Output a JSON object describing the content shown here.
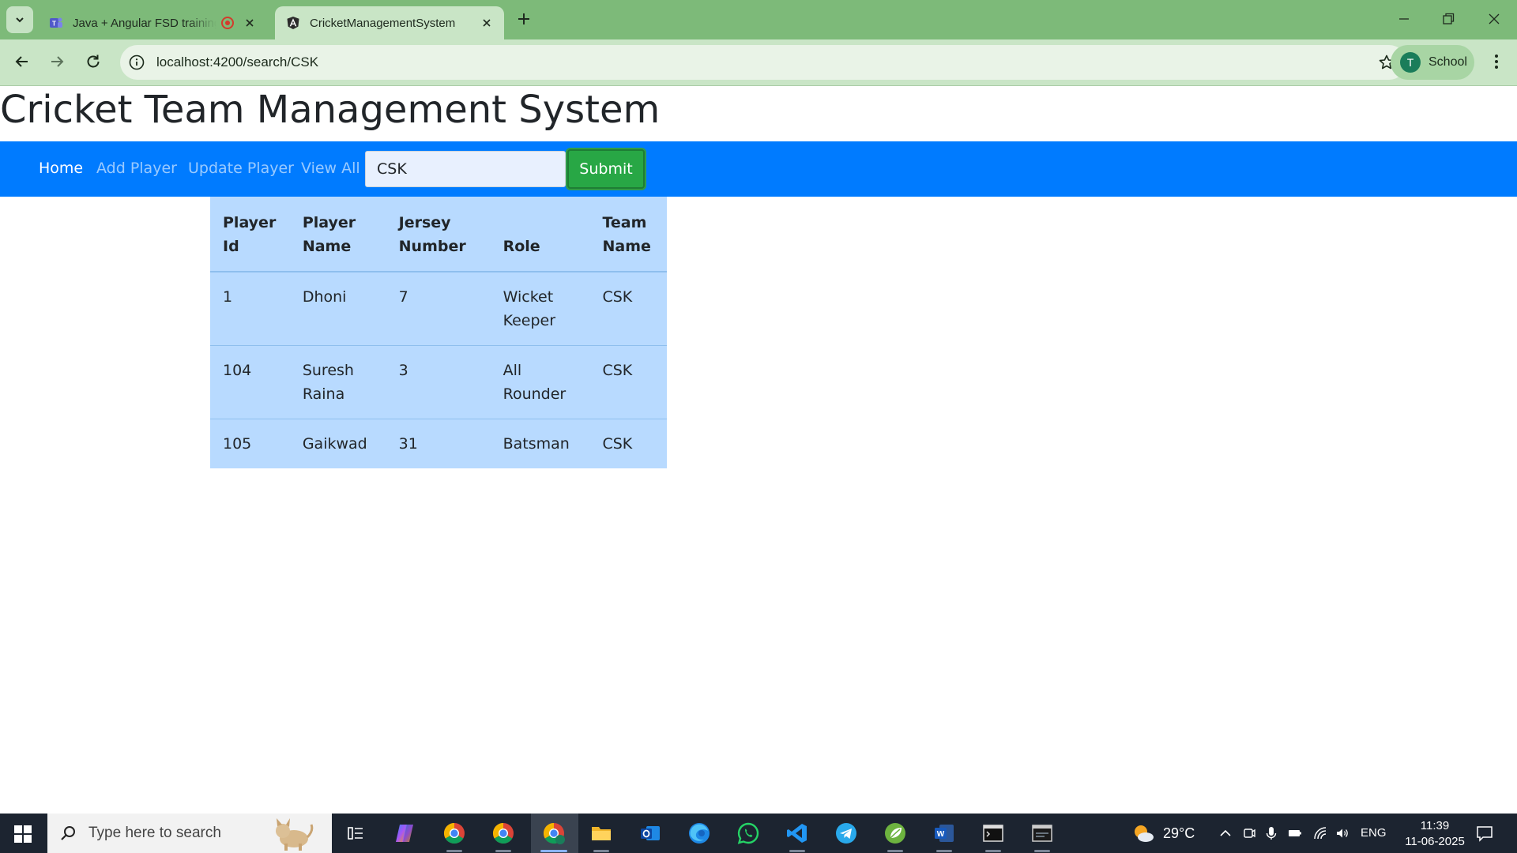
{
  "browser": {
    "tabs": [
      {
        "title": "Java + Angular FSD training"
      },
      {
        "title": "CricketManagementSystem"
      }
    ],
    "url": "localhost:4200/search/CSK",
    "profile": {
      "initial": "T",
      "name": "School"
    }
  },
  "app": {
    "title": "Cricket Team Management System",
    "nav": {
      "home": "Home",
      "add_player": "Add Player",
      "update_player": "Update Player",
      "view_all": "View All",
      "search_value": "CSK",
      "submit": "Submit"
    },
    "table": {
      "headers": {
        "id": "Player Id",
        "name": "Player Name",
        "jersey": "Jersey Number",
        "role": "Role",
        "team": "Team Name"
      },
      "rows": [
        {
          "id": "1",
          "name": "Dhoni",
          "jersey": "7",
          "role": "Wicket Keeper",
          "team": "CSK"
        },
        {
          "id": "104",
          "name": "Suresh Raina",
          "jersey": "3",
          "role": "All Rounder",
          "team": "CSK"
        },
        {
          "id": "105",
          "name": "Gaikwad",
          "jersey": "31",
          "role": "Batsman",
          "team": "CSK"
        }
      ]
    }
  },
  "taskbar": {
    "search_placeholder": "Type here to search",
    "weather": "29°C",
    "language": "ENG",
    "time": "11:39",
    "date": "11-06-2025",
    "apps": [
      "task-view",
      "copilot",
      "chrome",
      "chrome",
      "chrome",
      "file-explorer",
      "outlook",
      "edge",
      "whatsapp",
      "vscode",
      "telegram",
      "spring-tools",
      "word",
      "terminal",
      "mysql"
    ]
  }
}
